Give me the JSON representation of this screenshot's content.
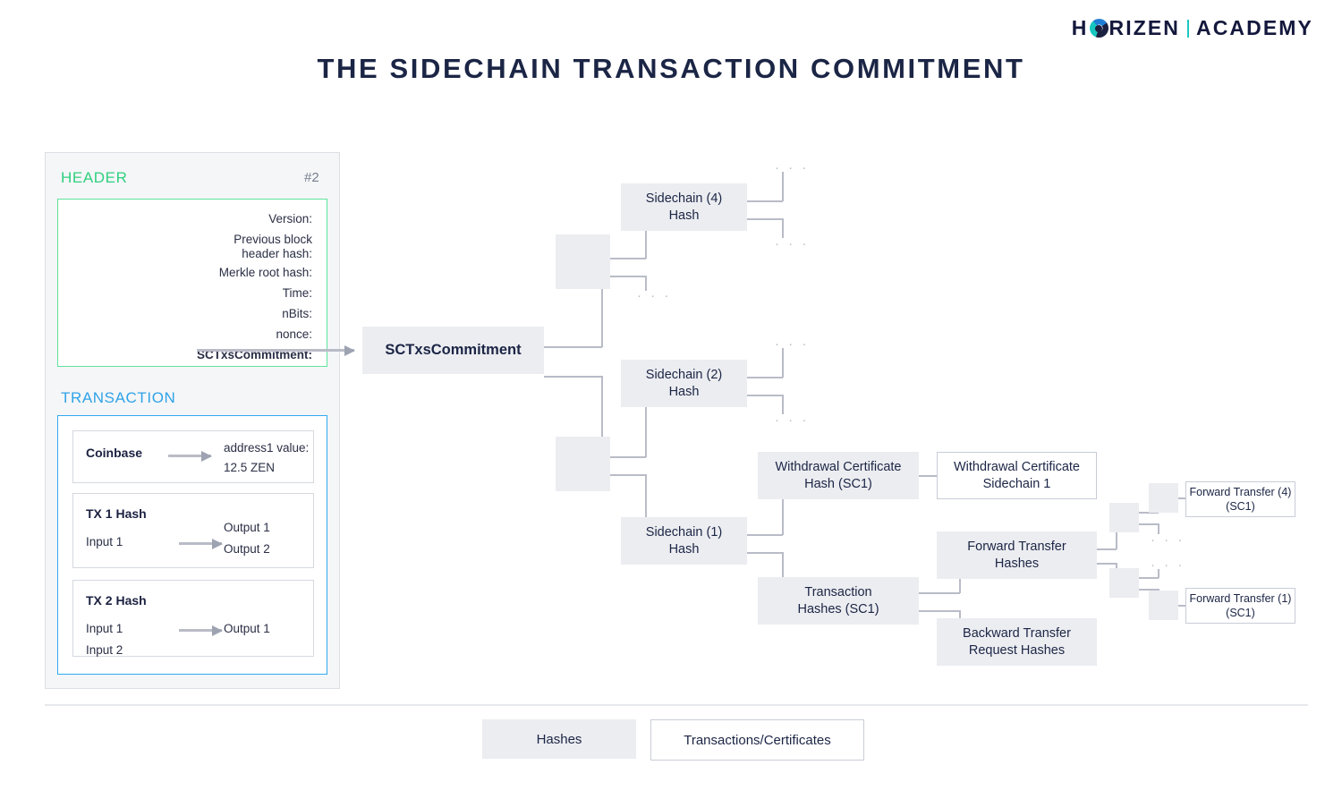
{
  "brand": {
    "name_part1": "H",
    "name_part2": "RIZEN",
    "name_part3": "ACADEMY"
  },
  "title": "THE SIDECHAIN TRANSACTION COMMITMENT",
  "block_panel": {
    "header_label": "HEADER",
    "block_number": "#2",
    "header_fields": [
      "Version:",
      "Previous block\nheader hash:",
      "Merkle root hash:",
      "Time:",
      "nBits:",
      "nonce:",
      "SCTxsCommitment:"
    ],
    "header_field_version": "Version:",
    "header_field_prevblock_line1": "Previous block",
    "header_field_prevblock_line2": "header hash:",
    "header_field_merkle": "Merkle root hash:",
    "header_field_time": "Time:",
    "header_field_nbits": "nBits:",
    "header_field_nonce": "nonce:",
    "header_field_sctxscommitment": "SCTxsCommitment:",
    "transaction_label": "TRANSACTION",
    "transactions": [
      {
        "title": "Coinbase",
        "inputs": [],
        "outputs": [
          "address1 value:",
          "12.5 ZEN"
        ]
      },
      {
        "title": "TX 1 Hash",
        "inputs": [
          "Input 1"
        ],
        "outputs": [
          "Output 1",
          "Output 2"
        ]
      },
      {
        "title": "TX 2 Hash",
        "inputs": [
          "Input 1",
          "Input 2"
        ],
        "outputs": [
          "Output 1"
        ]
      }
    ]
  },
  "tree": {
    "root": "SCTxsCommitment",
    "sidechain_4": "Sidechain (4)\nHash",
    "sidechain_4_l1": "Sidechain (4)",
    "sidechain_4_l2": "Hash",
    "sidechain_2_l1": "Sidechain (2)",
    "sidechain_2_l2": "Hash",
    "sidechain_1_l1": "Sidechain (1)",
    "sidechain_1_l2": "Hash",
    "withdrawal_cert_hash_l1": "Withdrawal Certificate",
    "withdrawal_cert_hash_l2": "Hash (SC1)",
    "withdrawal_cert_l1": "Withdrawal Certificate",
    "withdrawal_cert_l2": "Sidechain 1",
    "transaction_hashes_l1": "Transaction",
    "transaction_hashes_l2": "Hashes (SC1)",
    "forward_transfer_hashes_l1": "Forward Transfer",
    "forward_transfer_hashes_l2": "Hashes",
    "backward_transfer_l1": "Backward Transfer",
    "backward_transfer_l2": "Request Hashes",
    "forward_transfer_4_l1": "Forward Transfer (4)",
    "forward_transfer_4_l2": "(SC1)",
    "forward_transfer_1_l1": "Forward Transfer (1)",
    "forward_transfer_1_l2": "(SC1)",
    "ellipsis": "· · ·"
  },
  "legend": {
    "hashes": "Hashes",
    "transactions_certificates": "Transactions/Certificates"
  },
  "colors": {
    "hash_fill": "#ecedf1",
    "header_accent": "#2fd07e",
    "transaction_accent": "#2fa3e8",
    "line": "#b9bcc7",
    "text": "#1b2545",
    "brand_teal": "#1ec8c0"
  }
}
